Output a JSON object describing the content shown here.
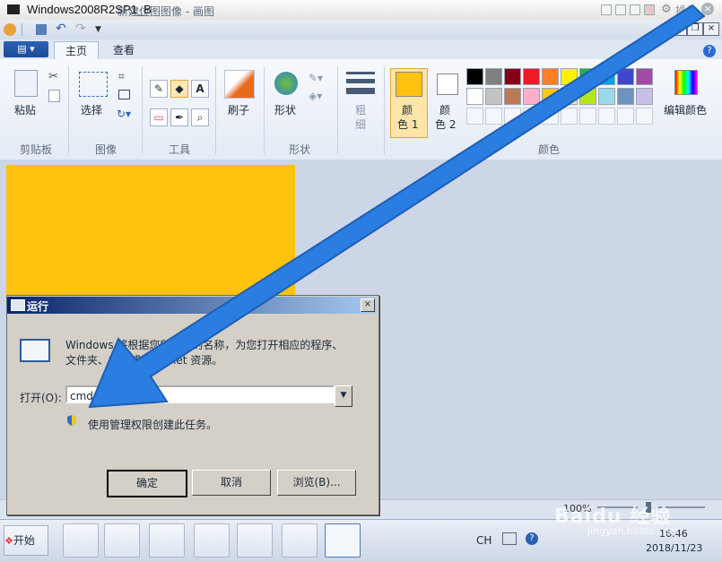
{
  "vm": {
    "title": "Windows2008R2SP1_B",
    "operate": "操作"
  },
  "paint": {
    "title": "新建位图图像 - 画图",
    "tabs": [
      "主页",
      "查看"
    ],
    "groups": {
      "clipboard": {
        "label": "剪贴板",
        "paste": "粘贴"
      },
      "image": {
        "label": "图像",
        "select": "选择"
      },
      "tools": {
        "label": "工具"
      },
      "brushes": {
        "label": "刷子"
      },
      "shapes": {
        "label": "形状",
        "shapes_btn": "形状"
      },
      "size": {
        "line1": "粗",
        "line2": "细"
      },
      "color1": {
        "line1": "颜",
        "line2": "色 1"
      },
      "color2": {
        "line1": "颜",
        "line2": "色 2"
      },
      "colors": {
        "label": "颜色",
        "edit": "编辑颜色"
      }
    },
    "palette_row1": [
      "#000000",
      "#7f7f7f",
      "#880015",
      "#ed1c24",
      "#ff7f27",
      "#fff200",
      "#22b14c",
      "#00a2e8",
      "#3f48cc",
      "#a349a4"
    ],
    "palette_row2": [
      "#ffffff",
      "#c3c3c3",
      "#b97a57",
      "#ffaec9",
      "#ffc90e",
      "#efe4b0",
      "#b5e61d",
      "#99d9ea",
      "#7092be",
      "#c8bfe7"
    ],
    "color1_value": "#ffc20e",
    "canvas_fill": "#ffc20e",
    "zoom": "100%"
  },
  "run_dialog": {
    "title": "运行",
    "desc_line1": "Windows 将根据您所输入的名称，为您打开相应的程序、",
    "desc_line2": "文件夹、文档或 Internet 资源。",
    "open_label": "打开(O):",
    "input_value": "cmd",
    "admin_note": "使用管理权限创建此任务。",
    "ok": "确定",
    "cancel": "取消",
    "browse": "浏览(B)..."
  },
  "taskbar": {
    "start": "开始",
    "ime": "CH",
    "time": "16:46",
    "date": "2018/11/23"
  },
  "watermark": {
    "brand": "Baidu 经验",
    "url": "jingyan.baidu.com"
  },
  "accent": "#2a7de1"
}
